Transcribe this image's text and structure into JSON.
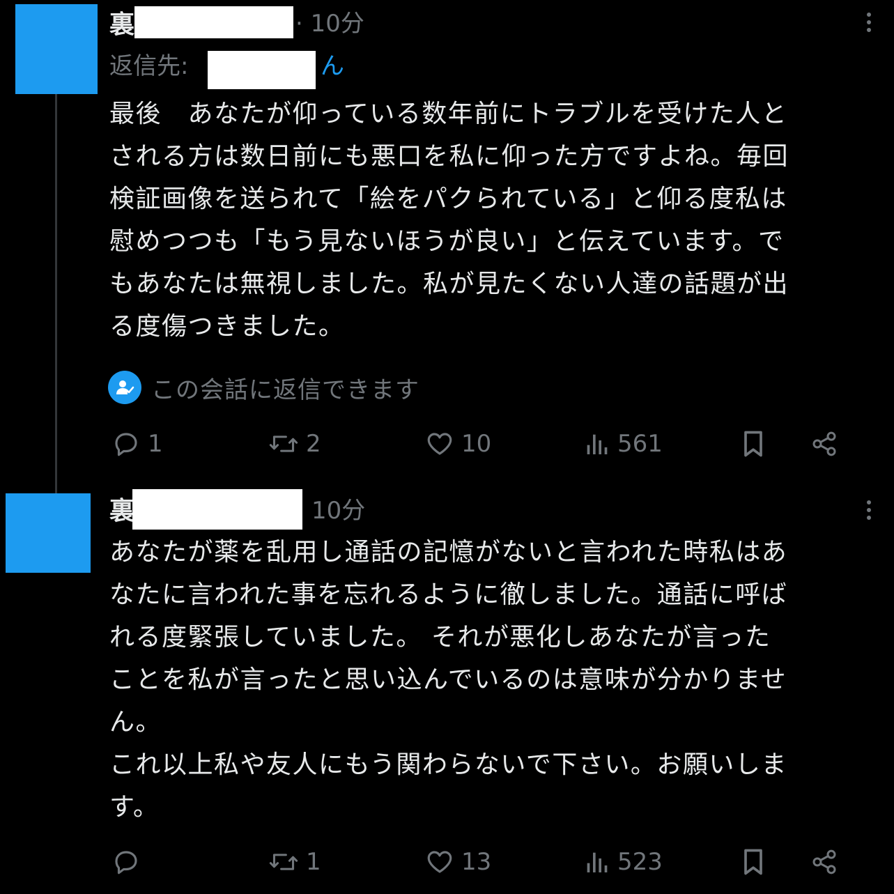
{
  "theme": {
    "background": "#000000",
    "text": "#e7e9ea",
    "muted": "#71767b",
    "accent": "#1d9bf0"
  },
  "tweets": [
    {
      "name_visible": "裏",
      "timestamp": "· 10分",
      "reply_to_label": "返信先:",
      "reply_to_suffix": "ん",
      "body": "最後　あなたが仰っている数年前にトラブルを受けた人と\nされる方は数日前にも悪口を私に仰った方ですよね。毎回\n検証画像を送られて「絵をパクられている」と仰る度私は\n慰めつつも「もう見ないほうが良い」と伝えています。で\nもあなたは無視しました。私が見たくない人達の話題が出\nる度傷つきました。",
      "notice": "この会話に返信できます",
      "actions": {
        "replies": "1",
        "reposts": "2",
        "likes": "10",
        "views": "561"
      }
    },
    {
      "name_visible": "裏",
      "timestamp": "10分",
      "body": "あなたが薬を乱用し通話の記憶がないと言われた時私はあ\nなたに言われた事を忘れるように徹しました。通話に呼ば\nれる度緊張していました。 それが悪化しあなたが言った\nことを私が言ったと思い込んでいるのは意味が分かりませ\nん。\nこれ以上私や友人にもう関わらないで下さい。お願いしま\nす。",
      "actions": {
        "replies": "",
        "reposts": "1",
        "likes": "13",
        "views": "523"
      }
    }
  ]
}
